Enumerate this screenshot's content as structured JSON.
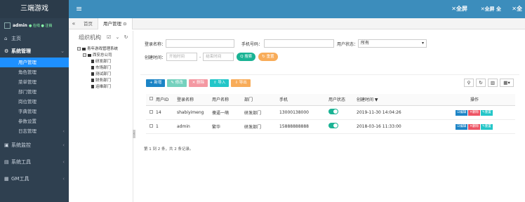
{
  "brand": "三端游戏",
  "user": {
    "name": "admin",
    "status": "● 在线  ● 注销"
  },
  "sidebar": {
    "items": [
      {
        "label": "主页",
        "icon": "home-icon"
      },
      {
        "label": "系统管理",
        "icon": "gear-icon",
        "open": true
      },
      {
        "label": "系统监控",
        "icon": "monitor-icon"
      },
      {
        "label": "系统工具",
        "icon": "tool-icon"
      },
      {
        "label": "GM工具",
        "icon": "gm-icon"
      }
    ],
    "subitems": [
      "用户管理",
      "角色管理",
      "菜单管理",
      "部门管理",
      "岗位管理",
      "字典管理",
      "参数设置",
      "日志管理"
    ]
  },
  "topbar": {
    "menu_icon": "≡",
    "fullscreen": "✕全屏",
    "fullscreen2": "✕全屏 全",
    "fullscreen3": "✕全"
  },
  "tabs": {
    "home": "首页",
    "current": "用户管理",
    "close": "⊙"
  },
  "org": {
    "title": "组织机构",
    "tools": "☑ ⌄ ↻",
    "root": "青年游戏管理系统",
    "company": "西安总公司",
    "depts": [
      "研发部门",
      "市场部门",
      "测试部门",
      "财务部门",
      "运维部门"
    ]
  },
  "search": {
    "login_label": "登录名称：",
    "phone_label": "手机号码：",
    "status_label": "用户状态：",
    "status_value": "所有",
    "time_label": "创建时间：",
    "start_placeholder": "开始时间",
    "end_placeholder": "结束时间",
    "search_btn": "Q 搜索",
    "reset_btn": "↻ 重置"
  },
  "toolbar": {
    "add": "+ 新增",
    "edit": "✎ 修改",
    "delete": "✕ 删除",
    "import": "⇧ 导入",
    "export": "⇩ 导出"
  },
  "table": {
    "headers": [
      "",
      "用户ID",
      "登录名称",
      "用户名称",
      "部门",
      "手机",
      "用户状态",
      "创建时间 ▼",
      "操作"
    ],
    "rows": [
      {
        "id": "14",
        "login": "shabiyimeng",
        "name": "傻逼一萌",
        "dept": "研发部门",
        "phone": "13000138000",
        "time": "2019-11-30 14:04:26"
      },
      {
        "id": "1",
        "login": "admin",
        "name": "繁华",
        "dept": "研发部门",
        "phone": "15888888888",
        "time": "2018-03-16 11:33:00"
      }
    ],
    "actions": {
      "edit": "☑编辑",
      "del": "✕删除",
      "reset": "✎重置"
    }
  },
  "pager": "第 1 到 2 条，共 2 条记录。",
  "colors": {
    "sidebar": "#2f4050",
    "topbar": "#3c8dbc",
    "active": "#1e90ff",
    "green": "#1ab394"
  }
}
